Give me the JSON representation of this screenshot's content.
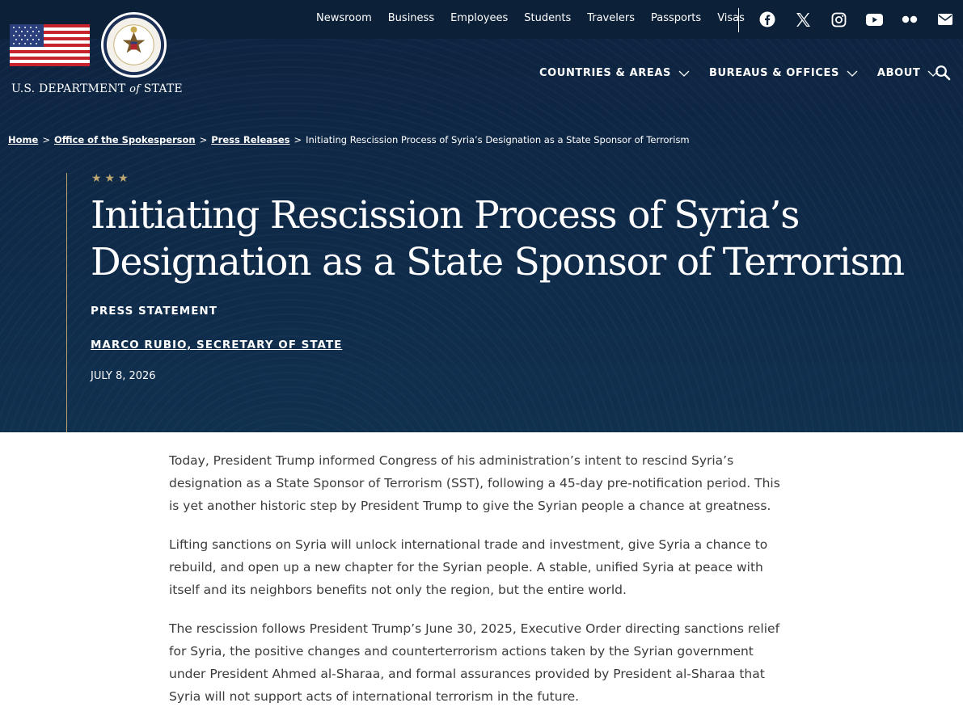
{
  "header": {
    "logo_text_pre": "U.S. DEPARTMENT",
    "logo_text_of": "of",
    "logo_text_post": "STATE",
    "utility_links": [
      "Newsroom",
      "Business",
      "Employees",
      "Students",
      "Travelers",
      "Passports",
      "Visas"
    ],
    "social_icons": [
      "facebook-icon",
      "x-icon",
      "instagram-icon",
      "youtube-icon",
      "flickr-icon",
      "email-icon"
    ],
    "main_nav": [
      "COUNTRIES & AREAS",
      "BUREAUS & OFFICES",
      "ABOUT"
    ]
  },
  "breadcrumb": {
    "home": "Home",
    "office": "Office of the Spokesperson",
    "section": "Press Releases",
    "current": "Initiating Rescission Process of Syria’s Designation as a State Sponsor of Terrorism"
  },
  "article": {
    "stars": "★★★",
    "title": "Initiating Rescission Process of Syria’s Designation as a State Sponsor of Terrorism",
    "doc_type": "PRESS STATEMENT",
    "author": "MARCO RUBIO, SECRETARY OF STATE",
    "date": "JULY 8, 2026",
    "paragraphs": [
      "Today, President Trump informed Congress of his administration’s intent to rescind Syria’s designation as a State Sponsor of Terrorism (SST), following a 45-day pre-notification period. This is yet another historic step by President Trump to give the Syrian people a chance at greatness.",
      "Lifting sanctions on Syria will unlock international trade and investment, give Syria a chance to rebuild, and open up a new chapter for the Syrian people.  A stable, unified Syria at peace with itself and its neighbors benefits not only the region, but the entire world.",
      "The rescission follows President Trump’s June 30, 2025, Executive Order directing sanctions relief for Syria, the positive changes and counterterrorism actions taken by the Syrian government under President Ahmed al-Sharaa, and formal assurances provided by President al-Sharaa that Syria will not support acts of international terrorism in the future."
    ]
  },
  "colors": {
    "hero_bg": "#0f2949",
    "topbar_bg": "#0c2038",
    "accent_gold": "#bfa771",
    "body_text": "#3b3b3b"
  }
}
